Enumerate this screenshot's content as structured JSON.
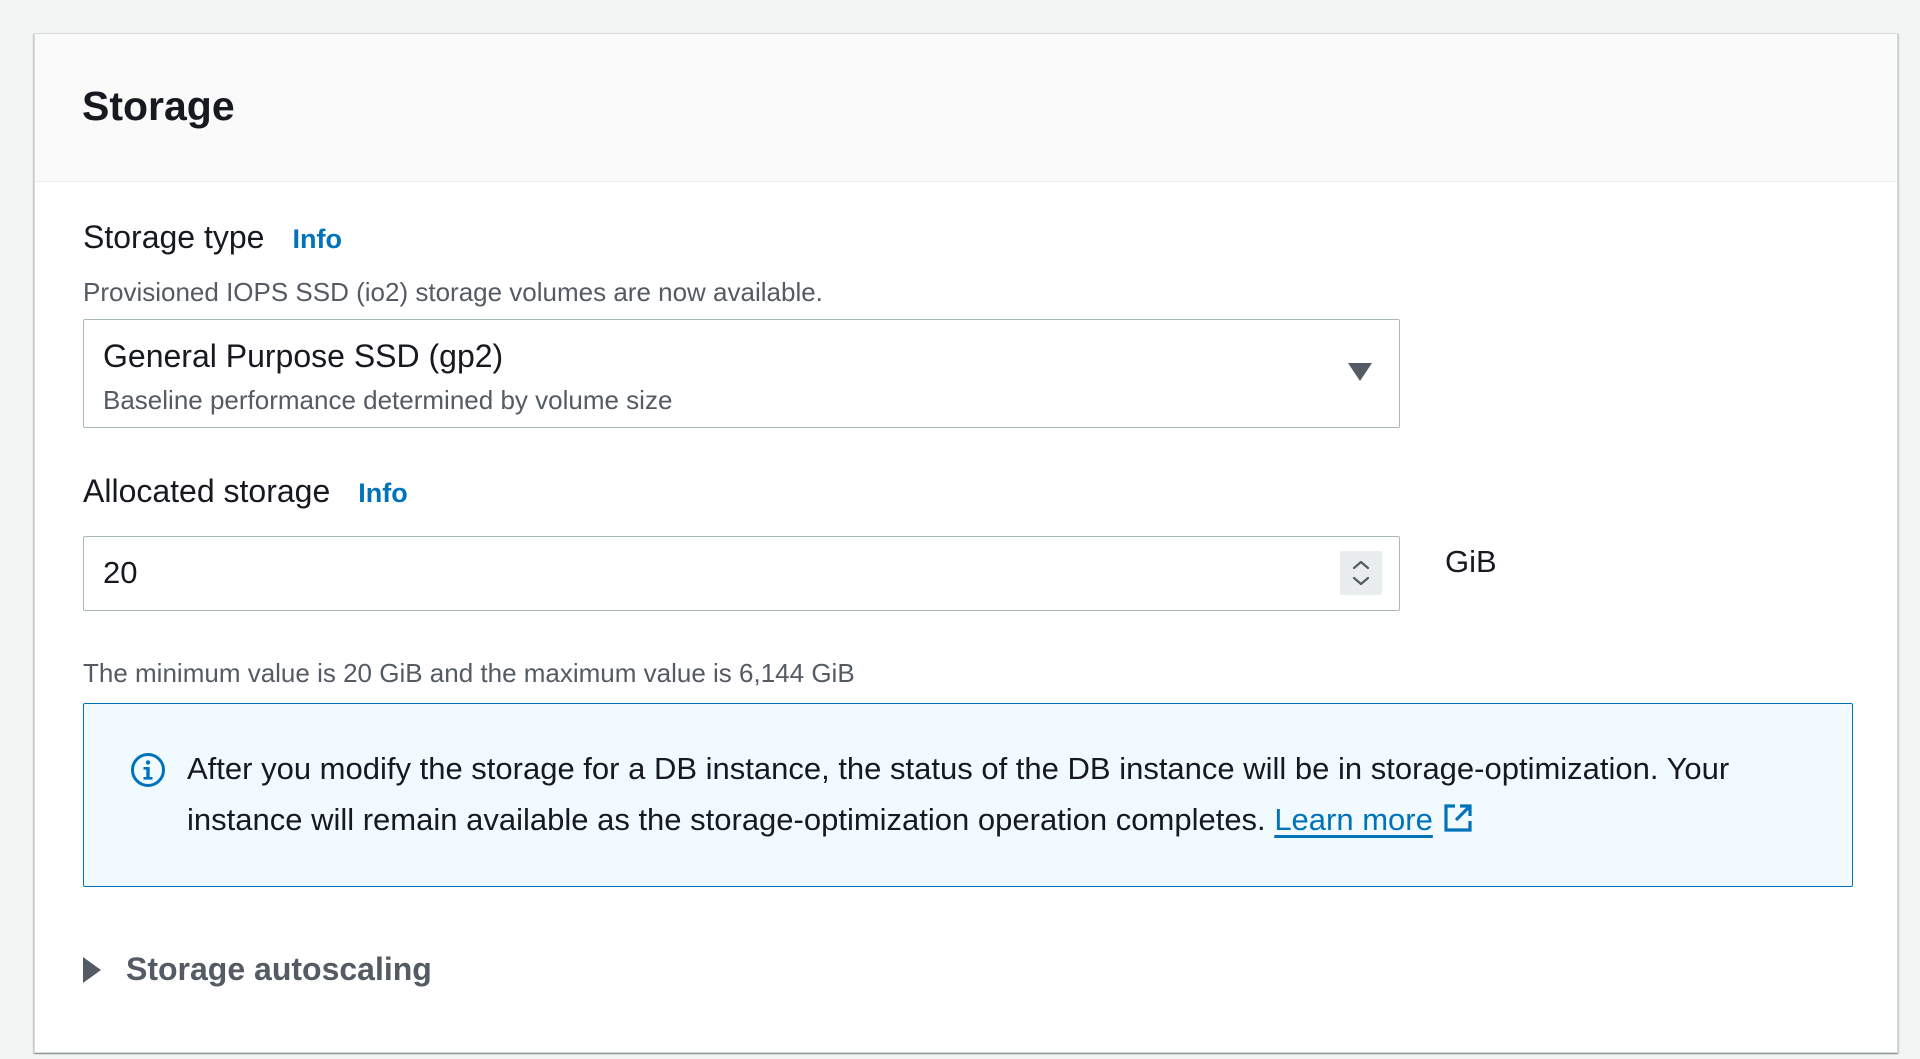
{
  "panel": {
    "title": "Storage"
  },
  "storage_type": {
    "label": "Storage type",
    "info_label": "Info",
    "description": "Provisioned IOPS SSD (io2) storage volumes are now available.",
    "selected_value": "General Purpose SSD (gp2)",
    "selected_description": "Baseline performance determined by volume size"
  },
  "allocated_storage": {
    "label": "Allocated storage",
    "info_label": "Info",
    "value": "20",
    "unit": "GiB",
    "constraint": "The minimum value is 20 GiB and the maximum value is 6,144 GiB"
  },
  "info_alert": {
    "icon": "info-circle-icon",
    "message": "After you modify the storage for a DB instance, the status of the DB instance will be in storage-optimization. Your instance will remain available as the storage-optimization operation completes.",
    "link_label": "Learn more",
    "link_icon": "external-link-icon",
    "accent_color": "#0073bb",
    "background_color": "#f1faff"
  },
  "autoscaling": {
    "label": "Storage autoscaling",
    "expanded": false
  }
}
